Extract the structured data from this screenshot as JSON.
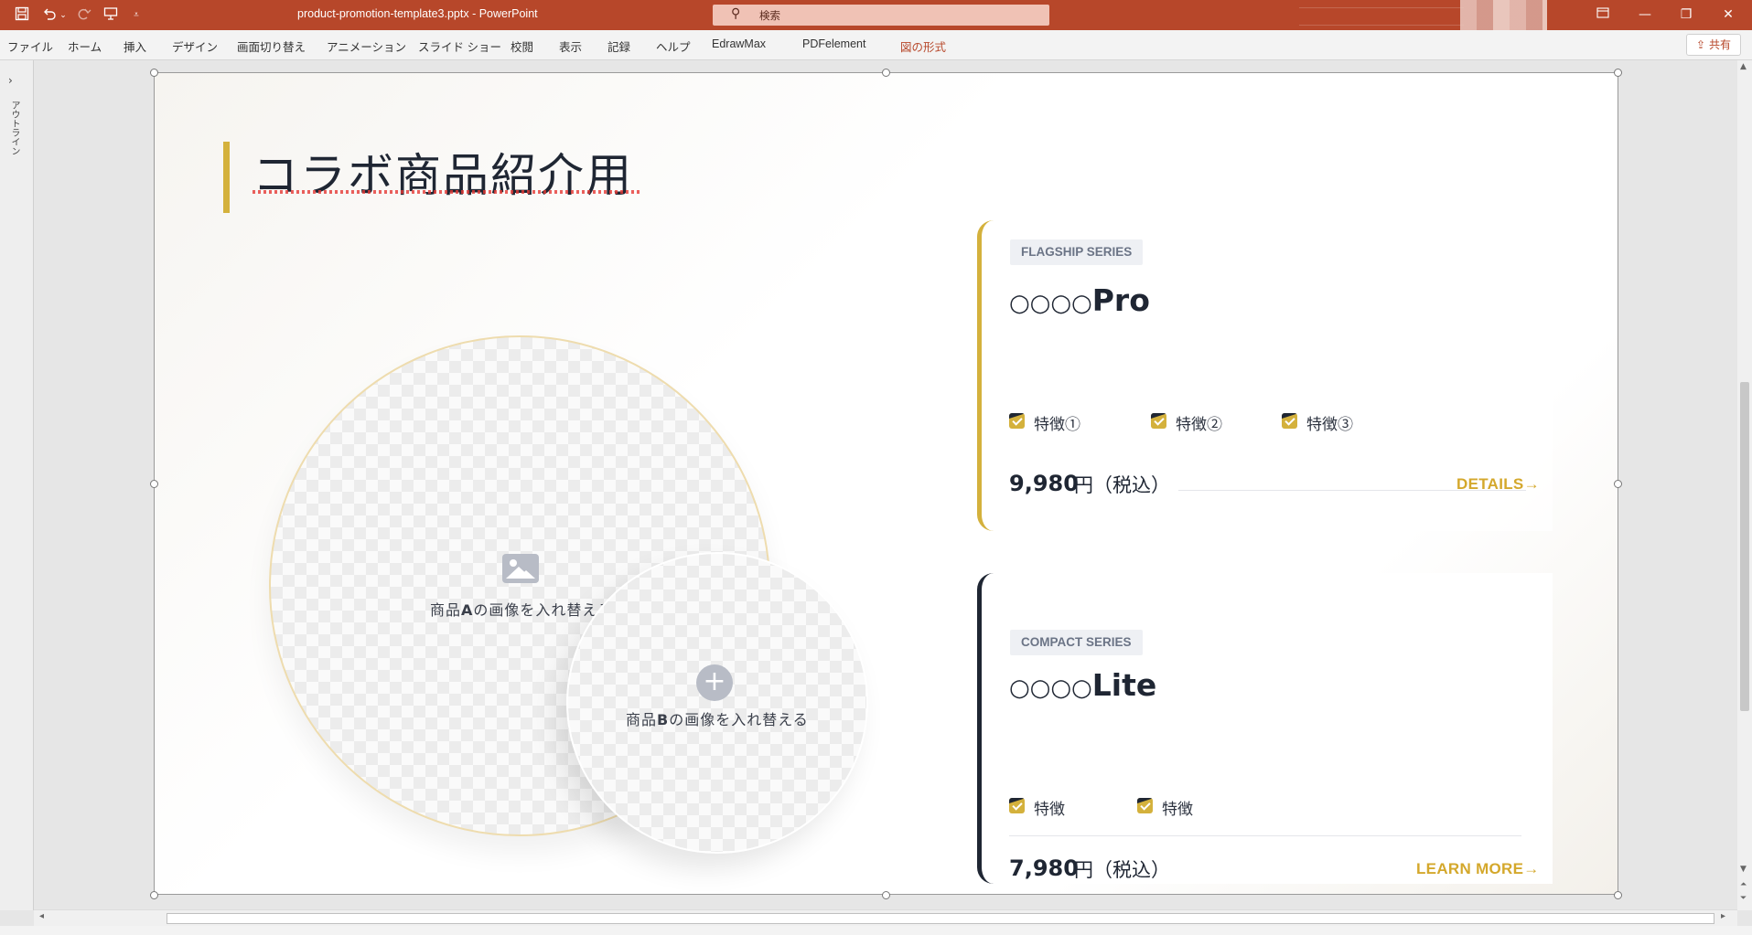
{
  "app": {
    "doc_title": "product-promotion-template3.pptx  -  PowerPoint",
    "search_placeholder": "検索",
    "share_label": "共有",
    "share_icon": "share-icon",
    "accent_color": "#b7472a"
  },
  "quick_access": {
    "icons": [
      "save-icon",
      "undo-icon",
      "redo-icon",
      "present-icon",
      "customize-icon"
    ]
  },
  "ribbon_tabs": [
    {
      "label": "ファイル"
    },
    {
      "label": "ホーム"
    },
    {
      "label": "挿入"
    },
    {
      "label": "デザイン"
    },
    {
      "label": "画面切り替え"
    },
    {
      "label": "アニメーション"
    },
    {
      "label": "スライド ショー"
    },
    {
      "label": "校閲"
    },
    {
      "label": "表示"
    },
    {
      "label": "記録"
    },
    {
      "label": "ヘルプ"
    },
    {
      "label": "EdrawMax"
    },
    {
      "label": "PDFelement"
    },
    {
      "label": "図の形式",
      "contextual": true
    }
  ],
  "outline_pane": {
    "label": "アウトライン"
  },
  "slide": {
    "title": "コラボ商品紹介用",
    "accent_color": "#d4b13c",
    "dark_color": "#1f2633",
    "image_a_label_prefix": "商品",
    "image_a_label_bold": "A",
    "image_a_label_suffix": "の画像を入れ替える",
    "image_b_label_prefix": "商品",
    "image_b_label_bold": "B",
    "image_b_label_suffix": "の画像を入れ替える",
    "image_a_icon": "image-icon",
    "image_b_icon": "plus-icon",
    "cards": [
      {
        "badge": "FLAGSHIP SERIES",
        "name_prefix": "○○○○",
        "name_suffix": "Pro",
        "features": [
          "特徴①",
          "特徴②",
          "特徴③"
        ],
        "price": "9,980",
        "price_unit": "円（税込）",
        "link": "DETAILS",
        "link_icon": "arrow-right-icon"
      },
      {
        "badge": "COMPACT SERIES",
        "name_prefix": "○○○○",
        "name_suffix": "Lite",
        "features": [
          "特徴",
          "特徴"
        ],
        "price": "7,980",
        "price_unit": "円（税込）",
        "link": "LEARN MORE",
        "link_icon": "arrow-right-icon"
      }
    ]
  },
  "window": {
    "buttons": [
      "ribbon-display-icon",
      "minimize-icon",
      "restore-icon",
      "close-icon"
    ]
  }
}
